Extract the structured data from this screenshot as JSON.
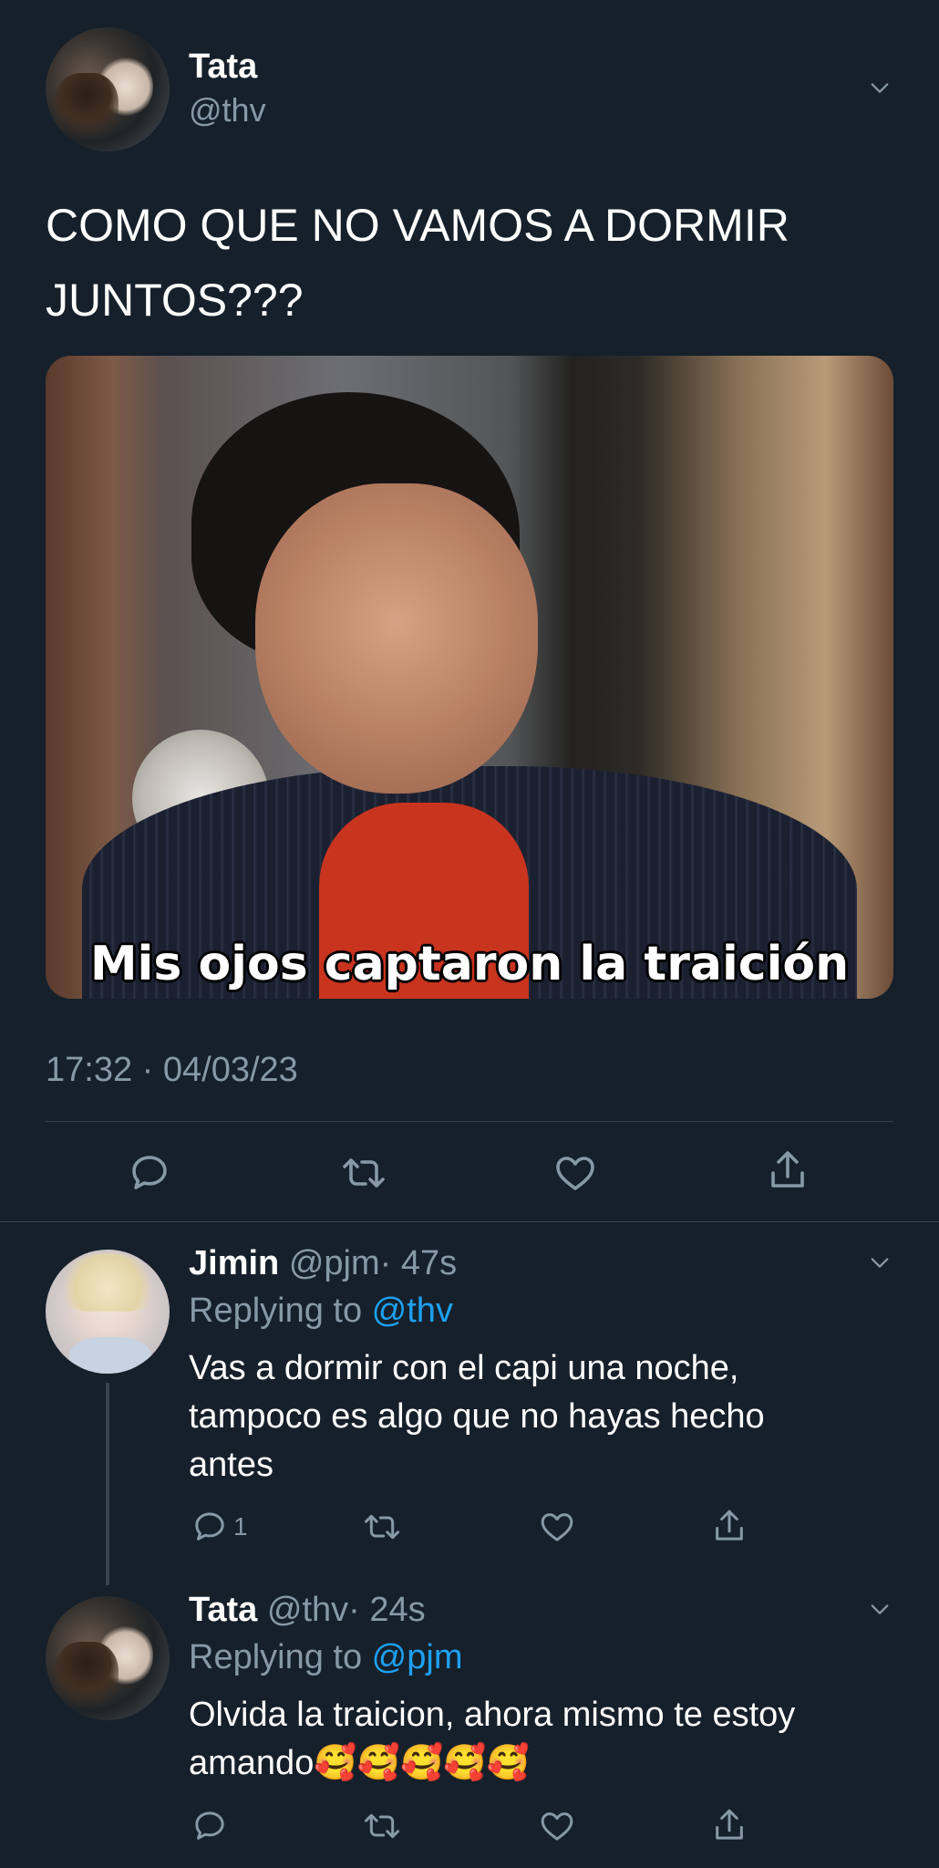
{
  "main_tweet": {
    "author_name": "Tata",
    "author_handle": "@thv",
    "text": "COMO QUE NO VAMOS A DORMIR JUNTOS???",
    "media_caption": "Mis ojos captaron la traición",
    "timestamp": "17:32 · 04/03/23",
    "actions": [
      "reply-icon",
      "retweet-icon",
      "like-icon",
      "share-icon"
    ]
  },
  "replies": [
    {
      "author_name": "Jimin",
      "author_handle": "@pjm",
      "time": "· 47s",
      "replying_prefix": "Replying to ",
      "replying_to": "@thv",
      "text": "Vas a dormir con el capi una noche, tampoco es algo que no hayas hecho antes",
      "reply_count": "1"
    },
    {
      "author_name": "Tata",
      "author_handle": "@thv",
      "time": "· 24s",
      "replying_prefix": "Replying to ",
      "replying_to": "@pjm",
      "text": "Olvida la traicion, ahora mismo te estoy amando🥰🥰🥰🥰🥰",
      "reply_count": ""
    }
  ],
  "colors": {
    "background": "#15202b",
    "muted": "#8899a6",
    "link": "#1da1f2",
    "divider": "#38444d"
  }
}
